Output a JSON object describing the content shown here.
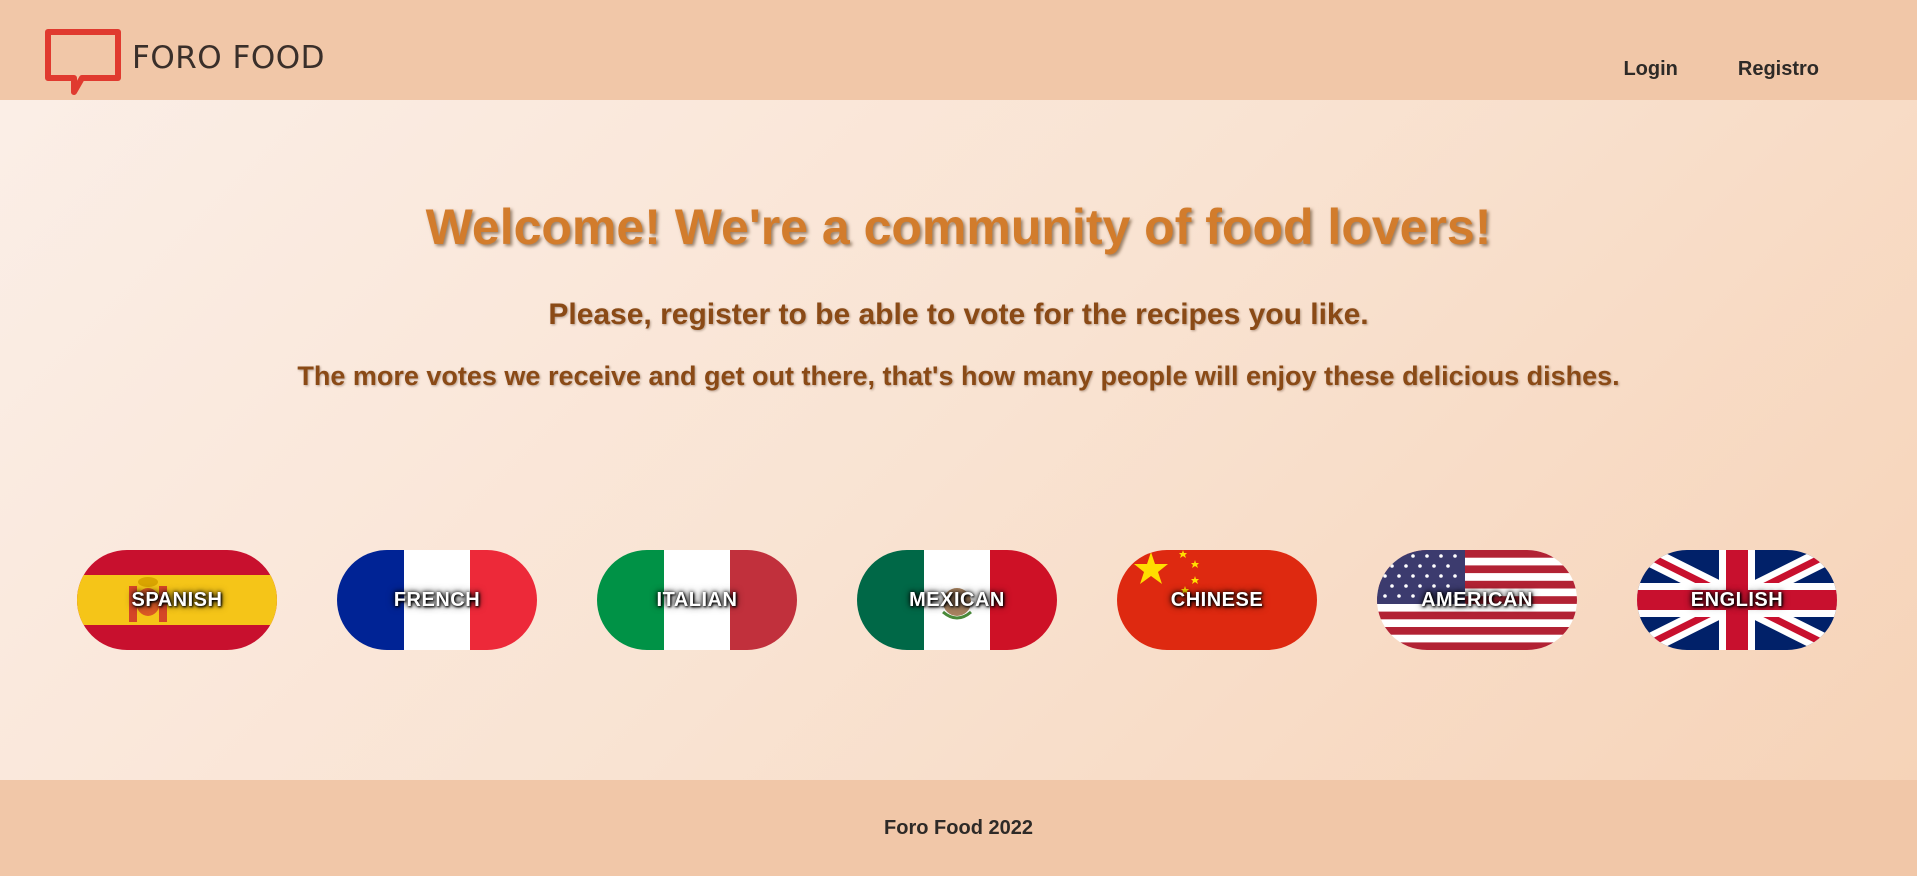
{
  "brand": {
    "name": "FORO FOOD",
    "logo_icon": "speech-bubble-icon",
    "logo_color": "#e03a2f"
  },
  "nav": {
    "login_label": "Login",
    "register_label": "Registro"
  },
  "hero": {
    "title": "Welcome! We're a community of food lovers!",
    "subtitle": "Please, register to be able to vote for the recipes you like.",
    "text": "The more votes we receive and get out there, that's how many people will enjoy these delicious dishes."
  },
  "cuisines": [
    {
      "label": "SPANISH",
      "flag": "spain-flag-icon"
    },
    {
      "label": "FRENCH",
      "flag": "france-flag-icon"
    },
    {
      "label": "ITALIAN",
      "flag": "italy-flag-icon"
    },
    {
      "label": "MEXICAN",
      "flag": "mexico-flag-icon"
    },
    {
      "label": "CHINESE",
      "flag": "china-flag-icon"
    },
    {
      "label": "AMERICAN",
      "flag": "usa-flag-icon"
    },
    {
      "label": "ENGLISH",
      "flag": "uk-flag-icon"
    }
  ],
  "footer": {
    "text": "Foro Food 2022"
  },
  "colors": {
    "header_bg": "#f1c7a8",
    "title": "#d27c2c",
    "subtitle": "#8a4a16"
  }
}
